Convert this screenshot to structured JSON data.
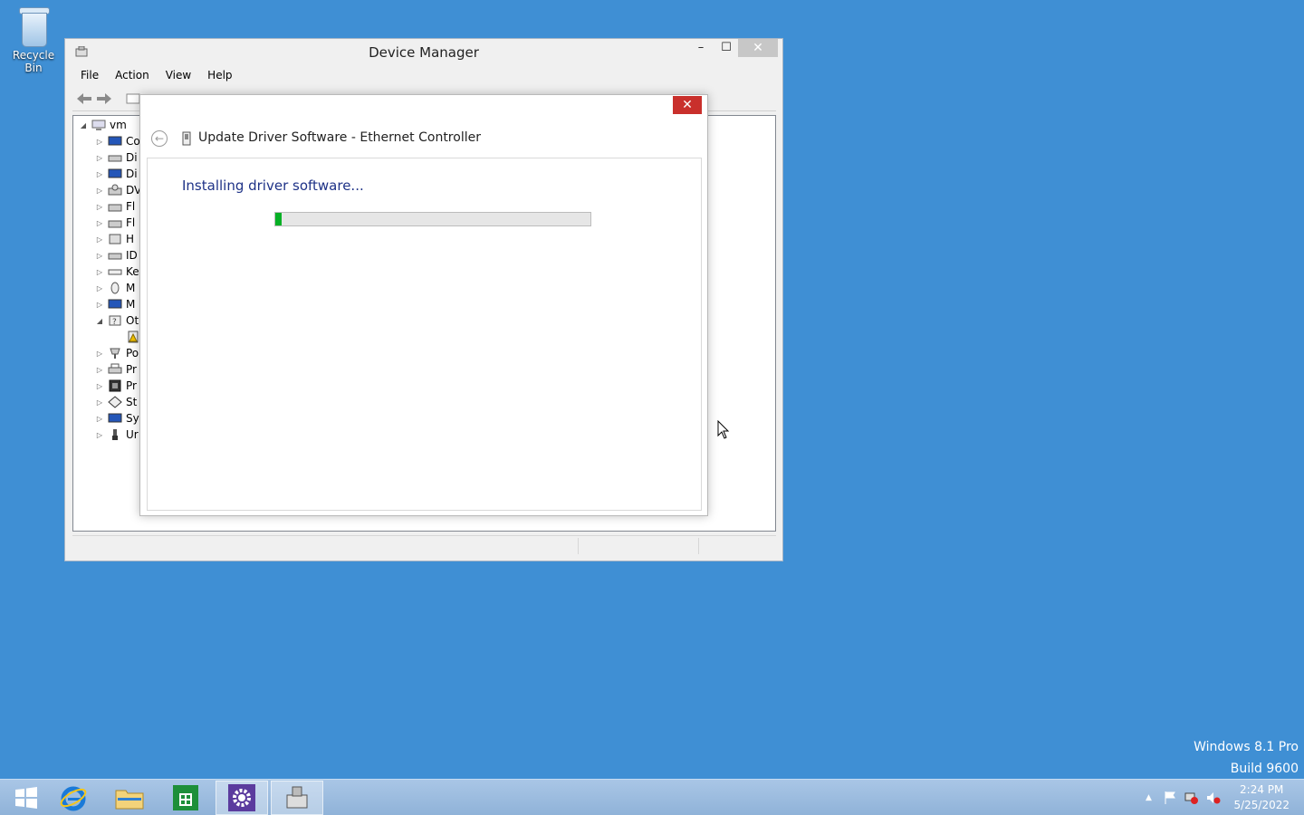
{
  "desktop": {
    "recycle_bin_label": "Recycle Bin",
    "watermark_line1": "Windows 8.1 Pro",
    "watermark_line2": "Build 9600"
  },
  "device_manager": {
    "title": "Device Manager",
    "menu": [
      "File",
      "Action",
      "View",
      "Help"
    ],
    "tree": {
      "root": "vm",
      "items": [
        "Co",
        "Di",
        "Di",
        "DV",
        "Fl",
        "Fl",
        "H",
        "ID",
        "Ke",
        "M",
        "M",
        "Ot",
        "",
        "Po",
        "Pr",
        "Pr",
        "St",
        "Sy",
        "Ur"
      ]
    }
  },
  "dialog": {
    "title": "Update Driver Software - Ethernet Controller",
    "message": "Installing driver software...",
    "progress_fraction": 0.02,
    "close_glyph": "✕",
    "back_glyph": "←"
  },
  "taskbar": {
    "clock_time": "2:24 PM",
    "clock_date": "5/25/2022",
    "apps": [
      "start-button",
      "internet-explorer-icon",
      "file-explorer-icon",
      "store-icon",
      "settings-icon",
      "device-manager-icon"
    ]
  },
  "colors": {
    "desktop": "#3f8fd4",
    "dialog_close": "#c9302c",
    "progress_fill": "#06b025",
    "message_text": "#1e3287"
  }
}
